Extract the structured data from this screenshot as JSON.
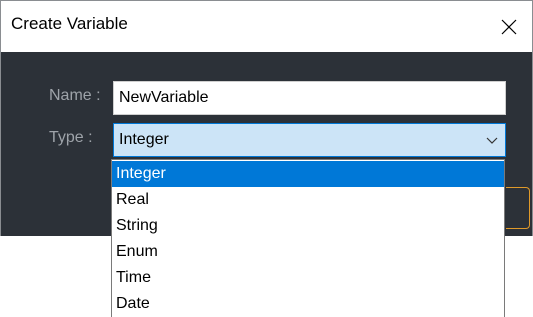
{
  "dialog": {
    "title": "Create Variable",
    "close_icon": "close-icon"
  },
  "form": {
    "name_label": "Name :",
    "name_value": "NewVariable",
    "type_label": "Type :",
    "type_value": "Integer",
    "type_chevron_icon": "chevron-down-icon"
  },
  "dropdown": {
    "options": [
      "Integer",
      "Real",
      "String",
      "Enum",
      "Time",
      "Date"
    ],
    "selected": "Integer"
  },
  "colors": {
    "body_background": "#2c3138",
    "select_background": "#cce4f7",
    "selection_accent": "#0078d7",
    "button_border": "#e09a2a"
  }
}
